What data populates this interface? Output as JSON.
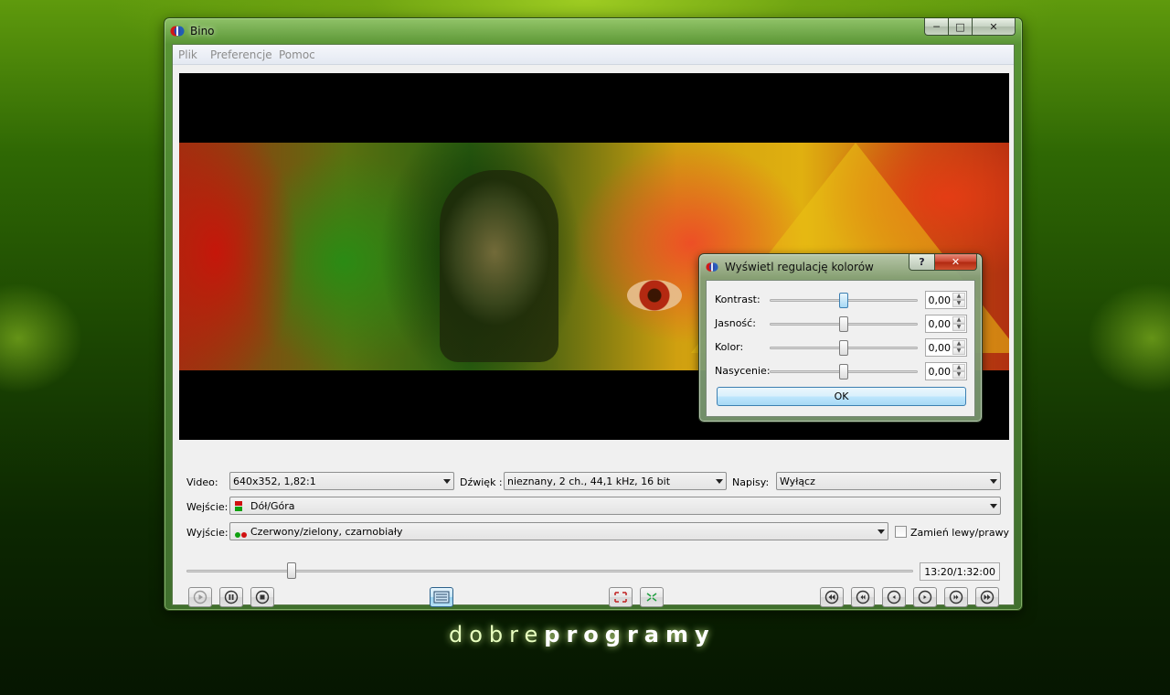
{
  "window": {
    "title": "Bino"
  },
  "menu": {
    "items": [
      "Plik",
      "Preferencje",
      "Pomoc"
    ]
  },
  "controls": {
    "video_label": "Video:",
    "video_value": "640x352, 1,82:1",
    "audio_label": "Dźwięk :",
    "audio_value": "nieznany, 2 ch., 44,1 kHz, 16 bit",
    "subs_label": "Napisy:",
    "subs_value": "Wyłącz",
    "input_label": "Wejście:",
    "input_value": "Dół/Góra",
    "output_label": "Wyjście:",
    "output_value": "Czerwony/zielony, czarnobiały",
    "swap_label": "Zamień lewy/prawy",
    "swap_checked": false,
    "time": "13:20/1:32:00",
    "seek_fraction": 0.145
  },
  "dialog": {
    "title": "Wyświetl regulację kolorów",
    "help_label": "?",
    "rows": [
      {
        "label": "Kontrast:",
        "value": "0,00"
      },
      {
        "label": "Jasność:",
        "value": "0,00"
      },
      {
        "label": "Kolor:",
        "value": "0,00"
      },
      {
        "label": "Nasycenie:",
        "value": "0,00"
      }
    ],
    "ok_label": "OK"
  },
  "brand": {
    "part1": "dobre",
    "part2": "programy"
  },
  "colors": {
    "accent": "#3c7fb1",
    "anaglyph_red": "#d01010",
    "anaglyph_green": "#10a010"
  },
  "icons": {
    "transport": [
      "play-icon",
      "pause-icon",
      "stop-icon",
      "playlist-icon",
      "fullscreen-icon",
      "center-icon",
      "seek-back-far-icon",
      "seek-back-icon",
      "seek-back-small-icon",
      "seek-forward-small-icon",
      "seek-forward-icon",
      "seek-forward-far-icon"
    ]
  }
}
